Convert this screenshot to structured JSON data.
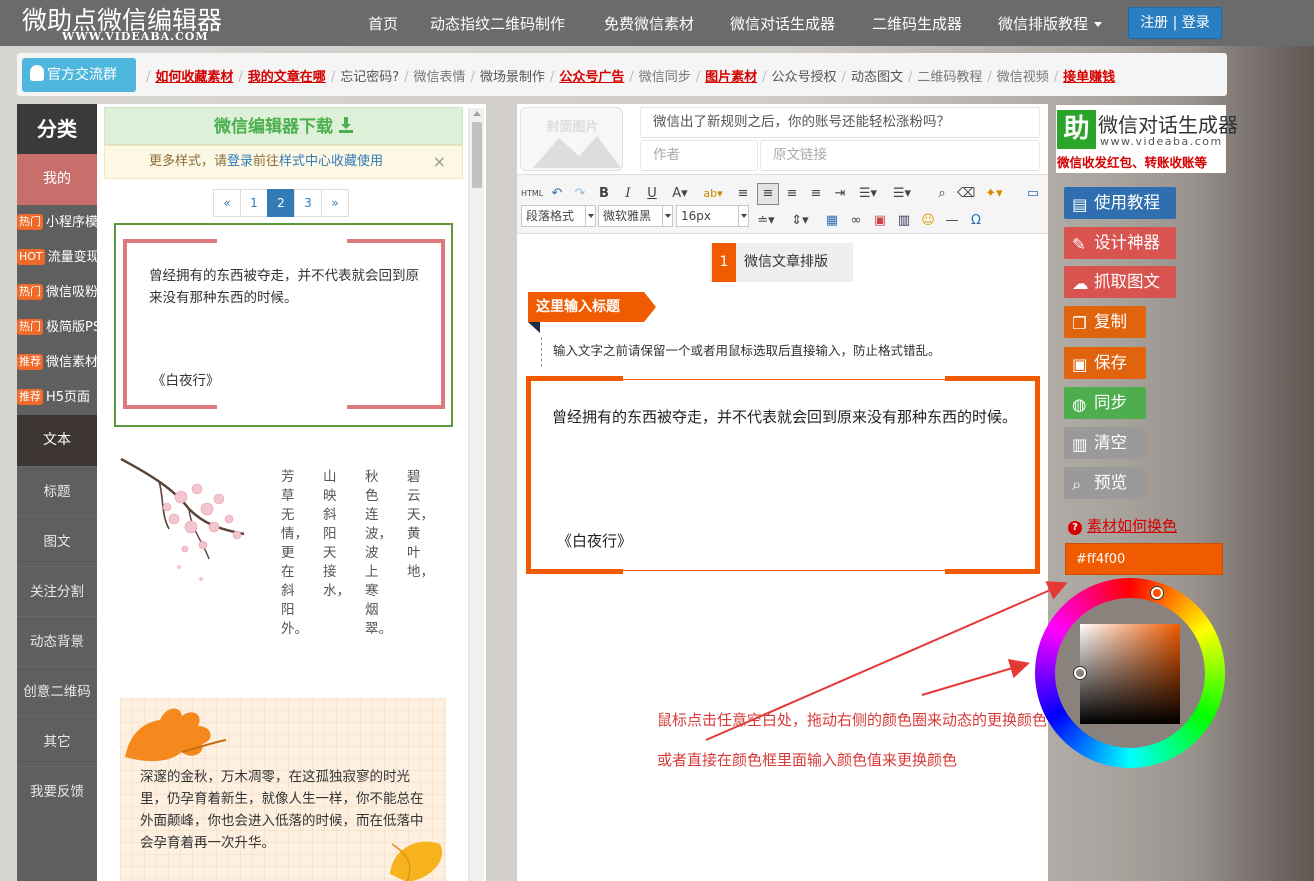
{
  "site": {
    "title": "微助点微信编辑器",
    "url": "WWW.VIDEABA.COM"
  },
  "nav": {
    "items": [
      "首页",
      "动态指纹二维码制作",
      "免费微信素材",
      "微信对话生成器",
      "二维码生成器",
      "微信排版教程"
    ],
    "login": "注册 | 登录"
  },
  "breadcrumb": {
    "group_button": "官方交流群",
    "items": [
      {
        "text": "如何收藏素材",
        "style": "red"
      },
      {
        "text": "我的文章在哪",
        "style": "red"
      },
      {
        "text": "忘记密码?",
        "style": "normal"
      },
      {
        "text": "微信表情",
        "style": "grey"
      },
      {
        "text": "微场景制作",
        "style": "normal"
      },
      {
        "text": "公众号广告",
        "style": "red"
      },
      {
        "text": "微信同步",
        "style": "grey"
      },
      {
        "text": "图片素材",
        "style": "red"
      },
      {
        "text": "公众号授权",
        "style": "normal"
      },
      {
        "text": "动态图文",
        "style": "normal"
      },
      {
        "text": "二维码教程",
        "style": "grey"
      },
      {
        "text": "微信视频",
        "style": "grey"
      },
      {
        "text": "接单赚钱",
        "style": "red"
      }
    ]
  },
  "sidebar": {
    "header": "分类",
    "mine": "我的",
    "subitems": [
      {
        "badge": "热门",
        "label": "小程序模板"
      },
      {
        "badge": "HOT",
        "label": "流量变现"
      },
      {
        "badge": "热门",
        "label": "微信吸粉"
      },
      {
        "badge": "热门",
        "label": "极简版PS"
      },
      {
        "badge": "推荐",
        "label": "微信素材"
      },
      {
        "badge": "推荐",
        "label": "H5页面"
      }
    ],
    "text_category": "文本",
    "categories": [
      "标题",
      "图文",
      "关注分割",
      "动态背景",
      "创意二维码",
      "其它",
      "我要反馈"
    ]
  },
  "templates": {
    "download": "微信编辑器下载",
    "notice_prefix": "更多样式，请",
    "notice_login": "登录",
    "notice_mid": "前往",
    "notice_link": "样式中心收藏使用",
    "close": "×",
    "pagination": [
      "«",
      "1",
      "2",
      "3",
      "»"
    ],
    "active_page": "2",
    "tpl1_text": "曾经拥有的东西被夺走，并不代表就会回到原来没有那种东西的时候。",
    "tpl1_sig": "《白夜行》",
    "poem_columns": [
      "芳草无情，更在斜阳外。",
      "山映斜阳天接水，",
      "秋色连波，波上寒烟翠。",
      "碧云天，黄叶地，"
    ],
    "tpl3_text": "深邃的金秋，万木凋零，在这孤独寂寥的时光里，仍孕育着新生，就像人生一样，你不能总在外面颠峰，你也会进入低落的时候，而在低落中会孕育着再一次升华。"
  },
  "editor": {
    "cover_label": "封面图片",
    "title_value": "微信出了新规则之后，你的账号还能轻松涨粉吗？",
    "author_placeholder": "作者",
    "link_placeholder": "原文链接",
    "toolbar": {
      "html": "HTML",
      "paragraph": "段落格式",
      "font": "微软雅黑",
      "size": "16px"
    },
    "number": "1",
    "section_title": "微信文章排版",
    "ribbon_title": "这里输入标题",
    "hint": "输入文字之前请保留一个或者用鼠标选取后直接输入，防止格式错乱。",
    "frame_text": "曾经拥有的东西被夺走，并不代表就会回到原来没有那种东西的时候。",
    "frame_sig": "《白夜行》"
  },
  "right": {
    "ad_icon": "助",
    "ad_title": "微信对话生成器",
    "ad_url": "www.videaba.com",
    "ad_sub": "微信收发红包、转账收账等",
    "buttons": [
      {
        "label": "使用教程",
        "color": "#2f6fb0",
        "icon": "book-icon"
      },
      {
        "label": "设计神器",
        "color": "#d9534f",
        "icon": "pencil-icon"
      },
      {
        "label": "抓取图文",
        "color": "#d9534f",
        "icon": "cloud-download-icon"
      },
      {
        "label": "复制",
        "color": "#e0640e",
        "icon": "copy-icon"
      },
      {
        "label": "保存",
        "color": "#e0640e",
        "icon": "save-icon"
      },
      {
        "label": "同步",
        "color": "#4cae4c",
        "icon": "wechat-icon"
      },
      {
        "label": "清空",
        "color": "#9a9a9a",
        "icon": "trash-icon"
      },
      {
        "label": "预览",
        "color": "#9a9a9a",
        "icon": "search-icon"
      }
    ],
    "howto": "素材如何换色",
    "color_value": "#ff4f00",
    "note1": "鼠标点击任意空白处，拖动右侧的颜色圈来动态的更换颜色",
    "note2": "或者直接在颜色框里面输入颜色值来更换颜色"
  },
  "colors": {
    "accent": "#f05a00",
    "nav": "#6b6b6b",
    "primary": "#337ab7",
    "frame": "#dd7a7e"
  }
}
